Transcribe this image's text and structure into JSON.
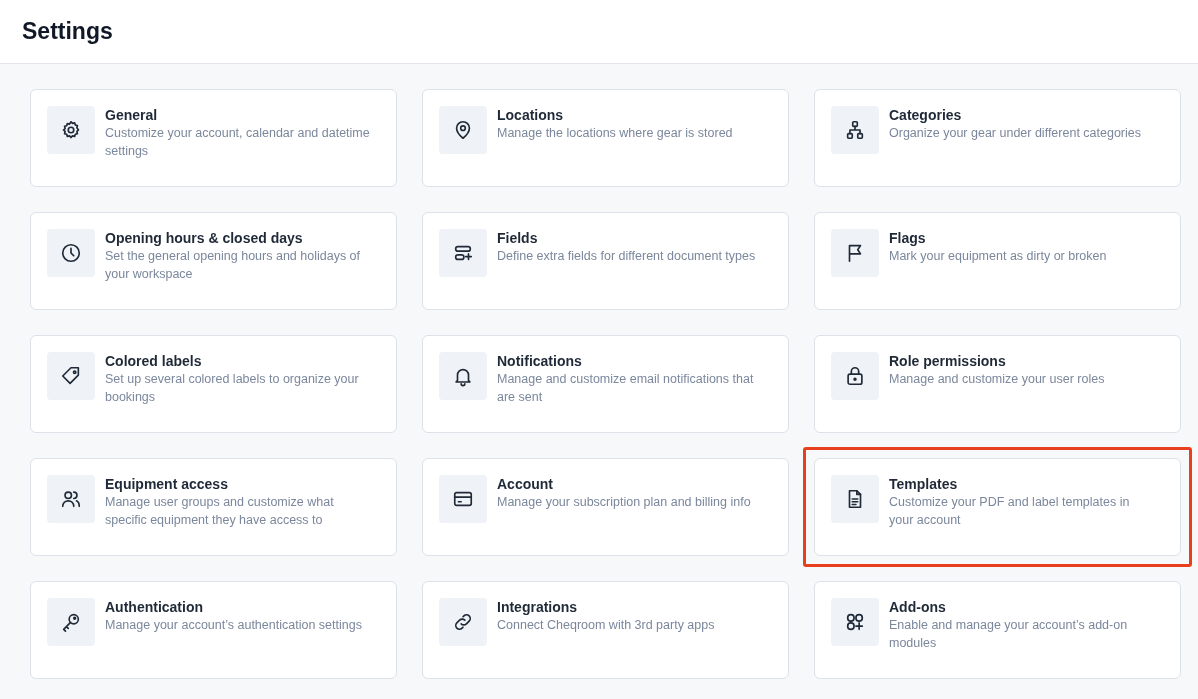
{
  "header": {
    "title": "Settings"
  },
  "cards": [
    {
      "title": "General",
      "description": "Customize your account, calendar and datetime settings",
      "highlighted": false
    },
    {
      "title": "Locations",
      "description": "Manage the locations where gear is stored",
      "highlighted": false
    },
    {
      "title": "Categories",
      "description": "Organize your gear under different categories",
      "highlighted": false
    },
    {
      "title": "Opening hours & closed days",
      "description": "Set the general opening hours and holidays of your workspace",
      "highlighted": false
    },
    {
      "title": "Fields",
      "description": "Define extra fields for different document types",
      "highlighted": false
    },
    {
      "title": "Flags",
      "description": "Mark your equipment as dirty or broken",
      "highlighted": false
    },
    {
      "title": "Colored labels",
      "description": "Set up several colored labels to organize your bookings",
      "highlighted": false
    },
    {
      "title": "Notifications",
      "description": "Manage and customize email notifications that are sent",
      "highlighted": false
    },
    {
      "title": "Role permissions",
      "description": "Manage and customize your user roles",
      "highlighted": false
    },
    {
      "title": "Equipment access",
      "description": "Manage user groups and customize what specific equipment they have access to",
      "highlighted": false
    },
    {
      "title": "Account",
      "description": "Manage your subscription plan and billing info",
      "highlighted": false
    },
    {
      "title": "Templates",
      "description": "Customize your PDF and label templates in your account",
      "highlighted": true
    },
    {
      "title": "Authentication",
      "description": "Manage your account’s authentication settings",
      "highlighted": false
    },
    {
      "title": "Integrations",
      "description": "Connect Cheqroom with 3rd party apps",
      "highlighted": false
    },
    {
      "title": "Add-ons",
      "description": "Enable and manage your account’s add-on modules",
      "highlighted": false
    }
  ]
}
